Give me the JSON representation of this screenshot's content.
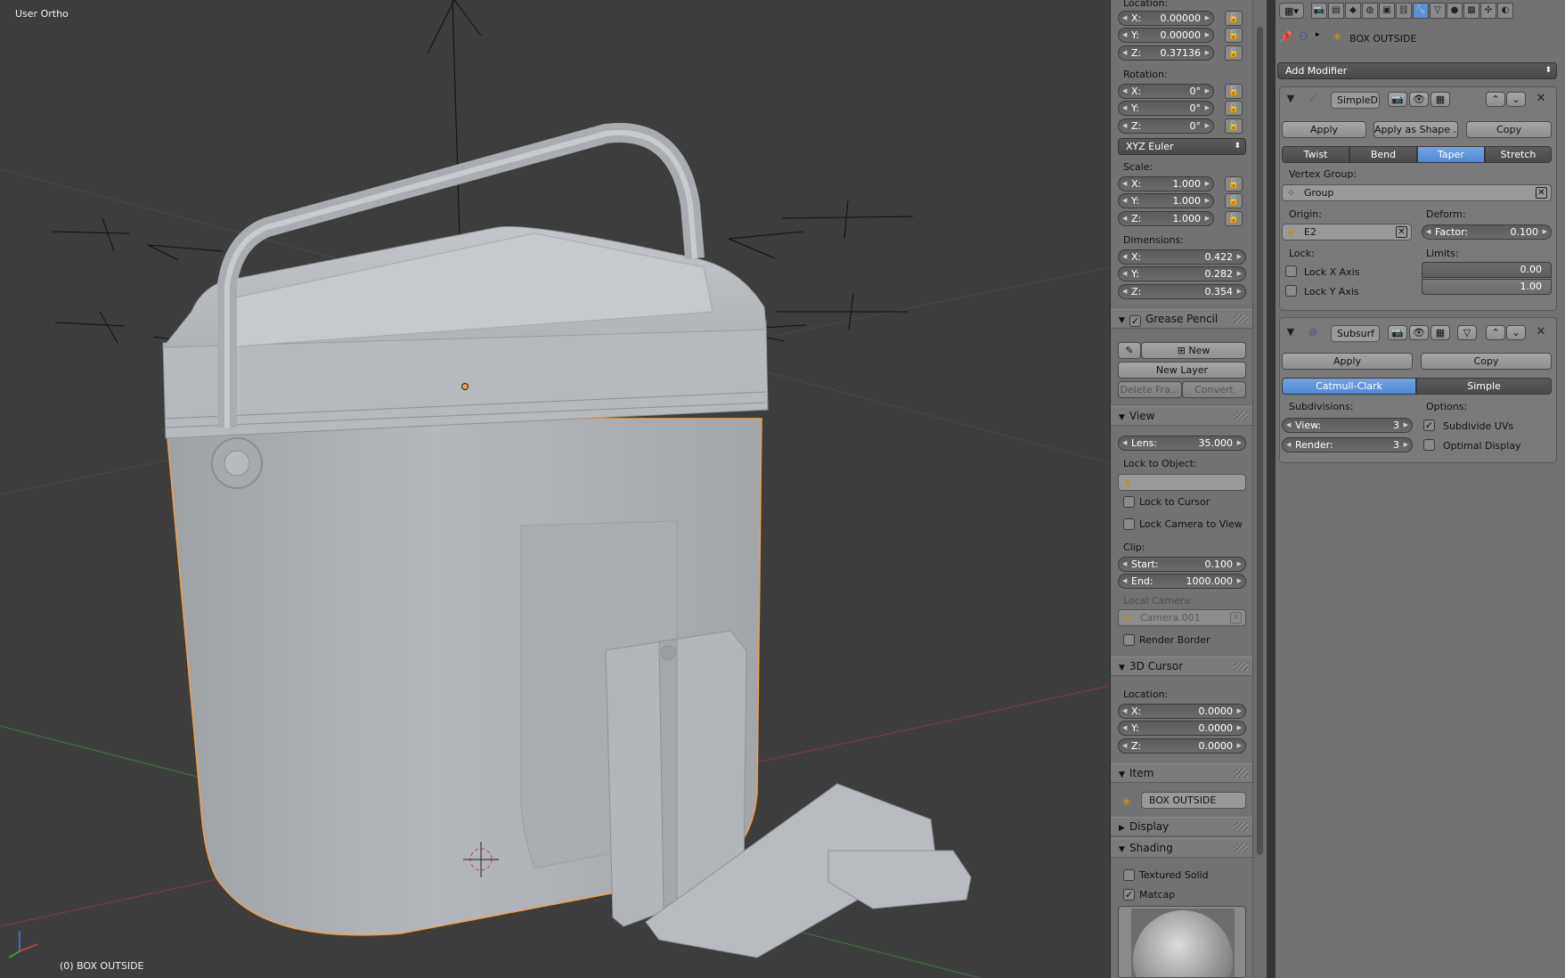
{
  "viewport": {
    "view_label": "User Ortho",
    "object_label": "(0) BOX OUTSIDE"
  },
  "transform": {
    "location_label": "Location:",
    "location": [
      {
        "k": "X:",
        "v": "0.00000"
      },
      {
        "k": "Y:",
        "v": "0.00000"
      },
      {
        "k": "Z:",
        "v": "0.37136"
      }
    ],
    "rotation_label": "Rotation:",
    "rotation": [
      {
        "k": "X:",
        "v": "0°"
      },
      {
        "k": "Y:",
        "v": "0°"
      },
      {
        "k": "Z:",
        "v": "0°"
      }
    ],
    "rotation_mode": "XYZ Euler",
    "scale_label": "Scale:",
    "scale": [
      {
        "k": "X:",
        "v": "1.000"
      },
      {
        "k": "Y:",
        "v": "1.000"
      },
      {
        "k": "Z:",
        "v": "1.000"
      }
    ],
    "dimensions_label": "Dimensions:",
    "dimensions": [
      {
        "k": "X:",
        "v": "0.422"
      },
      {
        "k": "Y:",
        "v": "0.282"
      },
      {
        "k": "Z:",
        "v": "0.354"
      }
    ]
  },
  "grease_pencil": {
    "title": "Grease Pencil",
    "new_label": "New",
    "new_layer_label": "New Layer",
    "delete_frame_label": "Delete Fra...",
    "convert_label": "Convert"
  },
  "view_panel": {
    "title": "View",
    "lens_k": "Lens:",
    "lens_v": "35.000",
    "lock_to_object_label": "Lock to Object:",
    "lock_to_cursor_label": "Lock to Cursor",
    "lock_camera_label": "Lock Camera to View",
    "clip_label": "Clip:",
    "clip_start_k": "Start:",
    "clip_start_v": "0.100",
    "clip_end_k": "End:",
    "clip_end_v": "1000.000",
    "local_camera_label": "Local Camera:",
    "local_camera_value": "Camera.001",
    "render_border_label": "Render Border"
  },
  "cursor_panel": {
    "title": "3D Cursor",
    "location_label": "Location:",
    "location": [
      {
        "k": "X:",
        "v": "0.0000"
      },
      {
        "k": "Y:",
        "v": "0.0000"
      },
      {
        "k": "Z:",
        "v": "0.0000"
      }
    ]
  },
  "item_panel": {
    "title": "Item",
    "name": "BOX OUTSIDE"
  },
  "display_panel": {
    "title": "Display"
  },
  "shading_panel": {
    "title": "Shading",
    "textured_solid_label": "Textured Solid",
    "matcap_label": "Matcap"
  },
  "properties": {
    "breadcrumb_object": "BOX OUTSIDE",
    "add_modifier_label": "Add Modifier",
    "simple_deform": {
      "name": "SimpleD",
      "apply_label": "Apply",
      "apply_shape_label": "Apply as Shape ...",
      "copy_label": "Copy",
      "modes": [
        "Twist",
        "Bend",
        "Taper",
        "Stretch"
      ],
      "active_mode": "Taper",
      "vertex_group_label": "Vertex Group:",
      "vertex_group_value": "Group",
      "origin_label": "Origin:",
      "origin_value": "E2",
      "deform_label": "Deform:",
      "factor_k": "Factor:",
      "factor_v": "0.100",
      "lock_label": "Lock:",
      "lock_x_label": "Lock X Axis",
      "lock_y_label": "Lock Y Axis",
      "limits_label": "Limits:",
      "limit_min": "0.00",
      "limit_max": "1.00"
    },
    "subsurf": {
      "name": "Subsurf",
      "apply_label": "Apply",
      "copy_label": "Copy",
      "modes": [
        "Catmull-Clark",
        "Simple"
      ],
      "active_mode": "Catmull-Clark",
      "subdivisions_label": "Subdivisions:",
      "view_k": "View:",
      "view_v": "3",
      "render_k": "Render:",
      "render_v": "3",
      "options_label": "Options:",
      "subdivide_uvs_label": "Subdivide UVs",
      "optimal_display_label": "Optimal Display"
    }
  },
  "colors": {
    "viewport_bg": "#3d3d3d",
    "panel_bg": "#727272",
    "active_blue": "#5680c2",
    "selection_outline": "#f0a04a"
  }
}
